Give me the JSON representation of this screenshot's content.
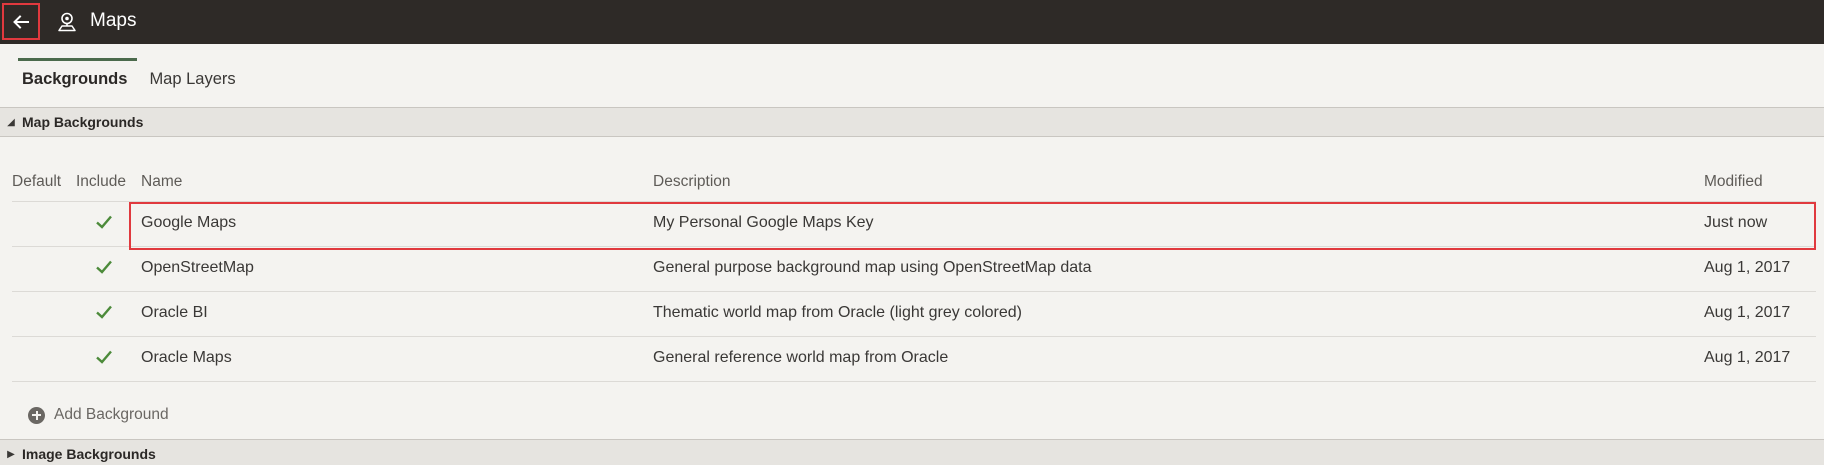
{
  "header": {
    "back_icon": "arrow-left-icon",
    "app_icon": "map-pin-icon",
    "title": "Maps"
  },
  "tabs": [
    {
      "label": "Backgrounds",
      "active": true
    },
    {
      "label": "Map Layers",
      "active": false
    }
  ],
  "sections": {
    "map_backgrounds": {
      "label": "Map Backgrounds",
      "expanded": true
    },
    "image_backgrounds": {
      "label": "Image Backgrounds",
      "expanded": false
    }
  },
  "table": {
    "columns": [
      "Default",
      "Include",
      "Name",
      "Description",
      "Modified"
    ],
    "rows": [
      {
        "default": "",
        "include": true,
        "name": "Google Maps",
        "description": "My Personal Google Maps Key",
        "modified": "Just now",
        "highlighted": true
      },
      {
        "default": "",
        "include": true,
        "name": "OpenStreetMap",
        "description": "General purpose background map using OpenStreetMap data",
        "modified": "Aug 1, 2017",
        "highlighted": false
      },
      {
        "default": "",
        "include": true,
        "name": "Oracle BI",
        "description": "Thematic world map from Oracle (light grey colored)",
        "modified": "Aug 1, 2017",
        "highlighted": false
      },
      {
        "default": "",
        "include": true,
        "name": "Oracle Maps",
        "description": "General reference world map from Oracle",
        "modified": "Aug 1, 2017",
        "highlighted": false
      }
    ]
  },
  "add_background": {
    "label": "Add Background",
    "icon": "plus-circle-icon"
  },
  "colors": {
    "header_bg": "#2e2a27",
    "highlight": "#e0393e",
    "check": "#4c8a3a",
    "tab_accent": "#4b6a4c"
  }
}
